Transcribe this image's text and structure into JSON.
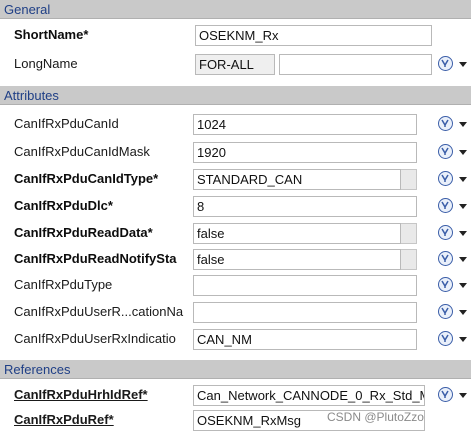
{
  "sections": {
    "general": "General",
    "attributes": "Attributes",
    "references": "References"
  },
  "general": {
    "short_name_label": "ShortName*",
    "short_name_value": "OSEKNM_Rx",
    "long_name_label": "LongName",
    "long_name_lang": "FOR-ALL",
    "long_name_value": ""
  },
  "attributes": [
    {
      "label": "CanIfRxPduCanId",
      "value": "1024"
    },
    {
      "label": "CanIfRxPduCanIdMask",
      "value": "1920"
    },
    {
      "label": "CanIfRxPduCanIdType*",
      "value": "STANDARD_CAN"
    },
    {
      "label": "CanIfRxPduDlc*",
      "value": "8"
    },
    {
      "label": "CanIfRxPduReadData*",
      "value": "false"
    },
    {
      "label": "CanIfRxPduReadNotifySta",
      "value": "false"
    },
    {
      "label": "CanIfRxPduType",
      "value": ""
    },
    {
      "label": "CanIfRxPduUserR...cationNa",
      "value": ""
    },
    {
      "label": "CanIfRxPduUserRxIndicatio",
      "value": "CAN_NM"
    }
  ],
  "references": [
    {
      "label": "CanIfRxPduHrhIdRef*",
      "value": "Can_Network_CANNODE_0_Rx_Std_M"
    },
    {
      "label": "CanIfRxPduRef*",
      "value": "OSEKNM_RxMsg"
    }
  ],
  "watermark": "CSDN @PlutoZzo",
  "icons": {
    "reset": "reset-default-icon",
    "menu": "chevron-down-icon"
  },
  "colors": {
    "section_text": "#1f3f86",
    "section_bg": "#c9c9c9",
    "icon_blue": "#3b5ea8"
  }
}
